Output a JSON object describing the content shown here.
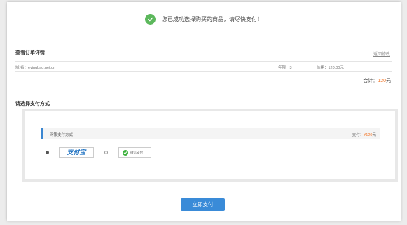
{
  "notice": {
    "text": "您已成功选择购买的商品，请尽快支付！",
    "icon": "check-circle-icon",
    "color": "#5cb85c"
  },
  "order": {
    "title": "查看订单详情",
    "edit_link": "返回修改",
    "domain": "域 名：eyingbao.net.cn",
    "years": "年限：3",
    "price": "价格：120.00元",
    "total_label": "合计：",
    "total_value": "120",
    "total_unit": "元"
  },
  "payment": {
    "title": "请选择支付方式",
    "method_label": "网银支付方式",
    "amount_label": "支付：",
    "amount_value": "¥120",
    "amount_unit": "元",
    "options": [
      {
        "label": "支付宝",
        "selected": true
      },
      {
        "label": "微信支付",
        "selected": false
      }
    ]
  },
  "submit": {
    "label": "立即支付",
    "color": "#3a8bd8"
  },
  "colors": {
    "accent": "#3a86d1",
    "price": "#f37b2f"
  }
}
